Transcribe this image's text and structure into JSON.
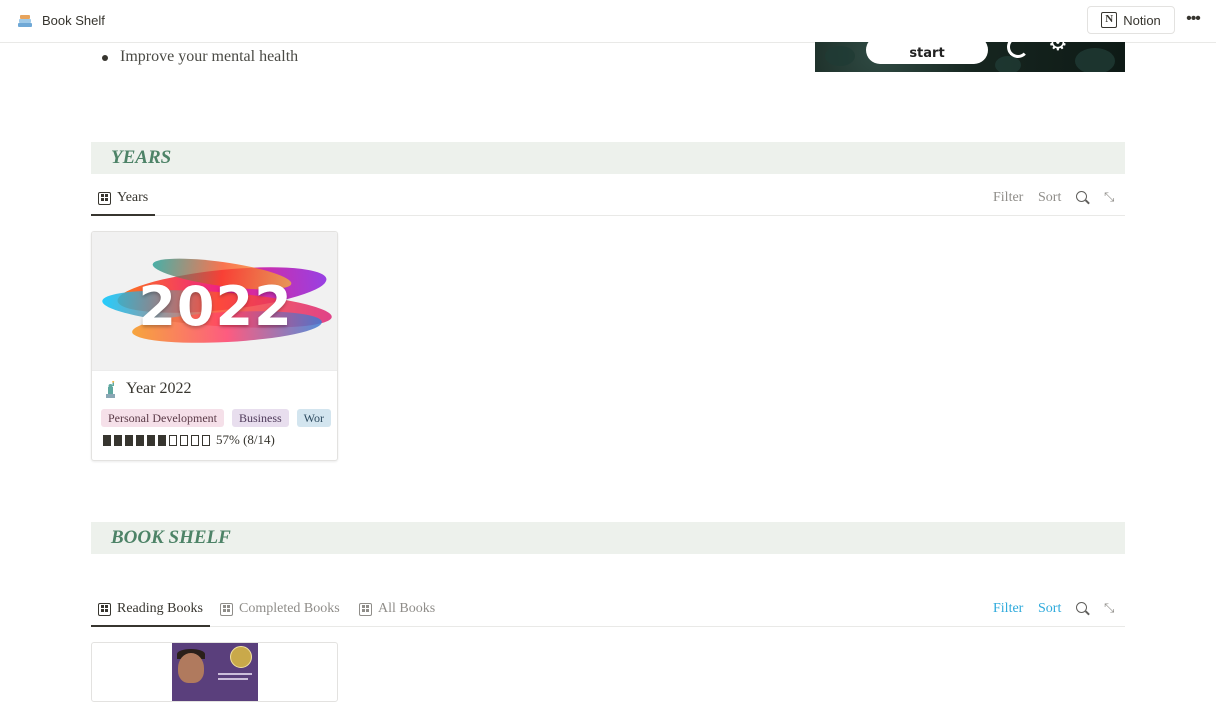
{
  "topbar": {
    "page_title": "Book Shelf",
    "page_icon": "books-icon",
    "notion_label": "Notion",
    "more_label": "•••"
  },
  "content": {
    "bullet_text": "Improve your mental health"
  },
  "hero": {
    "start_label": "start",
    "icons": [
      "moon-icon",
      "gear-icon"
    ]
  },
  "years_section": {
    "heading": "YEARS",
    "tabs": [
      {
        "label": "Years",
        "active": true
      }
    ],
    "toolbar": {
      "filter": "Filter",
      "sort": "Sort"
    },
    "cards": [
      {
        "cover_text": "2022",
        "icon": "statue-of-liberty-icon",
        "title": "Year 2022",
        "tags": [
          "Personal Development",
          "Business",
          "Wor"
        ],
        "progress_fraction": 0.57,
        "progress_blocks_filled": 6,
        "progress_blocks_total": 10,
        "progress_text": "57% (8/14)"
      }
    ]
  },
  "bookshelf_section": {
    "heading": "BOOK SHELF",
    "tabs": [
      {
        "label": "Reading Books",
        "active": true
      },
      {
        "label": "Completed Books",
        "active": false
      },
      {
        "label": "All Books",
        "active": false
      }
    ],
    "toolbar": {
      "filter": "Filter",
      "sort": "Sort"
    }
  },
  "colors": {
    "section_header_bg": "#edf1ec",
    "section_header_text": "#4d8367",
    "toolbar_active_blue": "#2eaadc",
    "tag_pink": "#f5e0e9",
    "tag_purple": "#e8deee",
    "tag_blue": "#d3e5ef"
  }
}
